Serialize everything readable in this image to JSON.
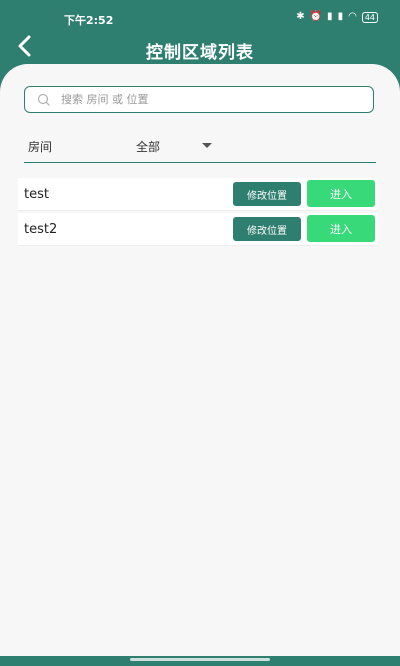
{
  "status_bar": {
    "time": "下午2:52",
    "icons": [
      "bluetooth-icon",
      "alarm-icon",
      "signal-icon",
      "signal-icon",
      "wifi-icon",
      "battery-icon"
    ],
    "signal_1": "▮",
    "signal_2": "▮",
    "battery": "44"
  },
  "header": {
    "title": "控制区域列表",
    "back_icon": "back-arrow-icon"
  },
  "search": {
    "placeholder": "搜索 房间 或 位置",
    "value": ""
  },
  "filter": {
    "label": "房间",
    "selected": "全部"
  },
  "list": {
    "edit_label": "修改位置",
    "enter_label": "进入",
    "items": [
      {
        "name": "test"
      },
      {
        "name": "test2"
      }
    ]
  },
  "colors": {
    "primary": "#2f7f70",
    "enter": "#37d979",
    "background": "#f7f7f7"
  }
}
